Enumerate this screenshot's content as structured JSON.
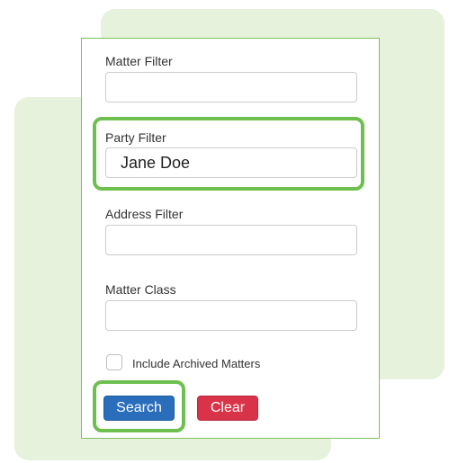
{
  "form": {
    "matter_filter": {
      "label": "Matter Filter",
      "value": ""
    },
    "party_filter": {
      "label": "Party Filter",
      "value": "Jane Doe"
    },
    "address_filter": {
      "label": "Address Filter",
      "value": ""
    },
    "matter_class": {
      "label": "Matter Class",
      "value": ""
    },
    "include_archived": {
      "label": "Include Archived Matters",
      "checked": false
    },
    "search_label": "Search",
    "clear_label": "Clear"
  },
  "colors": {
    "accent_green": "#6ec04e",
    "background_green": "#e6f2dc",
    "search_button": "#2a6ebb",
    "clear_button": "#d9334a"
  }
}
